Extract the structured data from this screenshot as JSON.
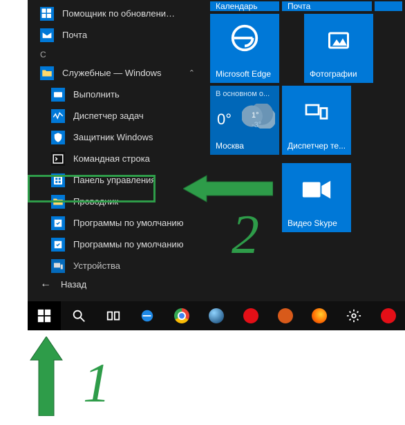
{
  "apps": {
    "section_letter": "С",
    "top": [
      {
        "label": "Помощник по обновлению до..."
      },
      {
        "label": "Почта"
      }
    ],
    "folder_label": "Служебные — Windows",
    "subs": [
      "Выполнить",
      "Диспетчер задач",
      "Защитник Windows",
      "Командная строка",
      "Панель управления",
      "Проводник",
      "Программы по умолчанию",
      "Программы по умолчанию",
      "Устройства"
    ],
    "back_label": "Назад",
    "highlighted_index": 4
  },
  "tiles": {
    "row1": {
      "left": "Календарь",
      "right": "Почта"
    },
    "edge": "Microsoft Edge",
    "photos": "Фотографии",
    "weather": {
      "top": "В основном о...",
      "main_temp": "0°",
      "hi": "1°",
      "lo": "-3°",
      "city": "Москва"
    },
    "dispatcher": "Диспетчер те...",
    "skype": "Видео Skype"
  },
  "annotations": {
    "num1": "1",
    "num2": "2"
  },
  "colors": {
    "tile_blue": "#0078d7",
    "accent_green": "#2e9c49"
  }
}
